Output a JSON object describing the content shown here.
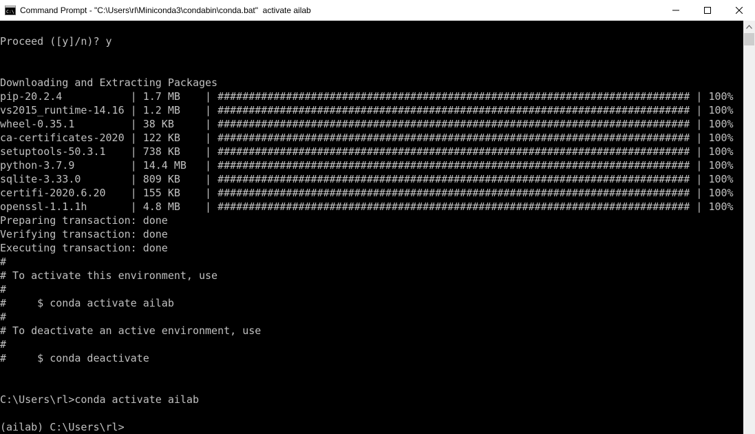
{
  "window": {
    "title": "Command Prompt - \"C:\\Users\\rl\\Miniconda3\\condabin\\conda.bat\"  activate ailab",
    "icon": "cmd-icon",
    "controls": [
      "minimize-icon",
      "maximize-icon",
      "close-icon"
    ]
  },
  "colors": {
    "console_bg": "#000000",
    "console_fg": "#c0c0c0",
    "titlebar_bg": "#ffffff",
    "scrollbar_bg": "#f0f0f0",
    "scrollbar_thumb": "#cdcdcd"
  },
  "console": {
    "pre_lines": [
      "",
      "Proceed ([y]/n)? y",
      "",
      "",
      "Downloading and Extracting Packages"
    ],
    "packages": [
      {
        "name": "pip-20.2.4",
        "size": "1.7 MB",
        "percent": "100%"
      },
      {
        "name": "vs2015_runtime-14.16",
        "size": "1.2 MB",
        "percent": "100%"
      },
      {
        "name": "wheel-0.35.1",
        "size": "38 KB",
        "percent": "100%"
      },
      {
        "name": "ca-certificates-2020",
        "size": "122 KB",
        "percent": "100%"
      },
      {
        "name": "setuptools-50.3.1",
        "size": "738 KB",
        "percent": "100%"
      },
      {
        "name": "python-3.7.9",
        "size": "14.4 MB",
        "percent": "100%"
      },
      {
        "name": "sqlite-3.33.0",
        "size": "809 KB",
        "percent": "100%"
      },
      {
        "name": "certifi-2020.6.20",
        "size": "155 KB",
        "percent": "100%"
      },
      {
        "name": "openssl-1.1.1h",
        "size": "4.8 MB",
        "percent": "100%"
      }
    ],
    "progress_fill": 1.0,
    "post_lines": [
      "Preparing transaction: done",
      "Verifying transaction: done",
      "Executing transaction: done",
      "#",
      "# To activate this environment, use",
      "#",
      "#     $ conda activate ailab",
      "#",
      "# To deactivate an active environment, use",
      "#",
      "#     $ conda deactivate",
      "",
      "",
      "C:\\Users\\rl>conda activate ailab",
      "",
      "(ailab) C:\\Users\\rl>"
    ]
  }
}
